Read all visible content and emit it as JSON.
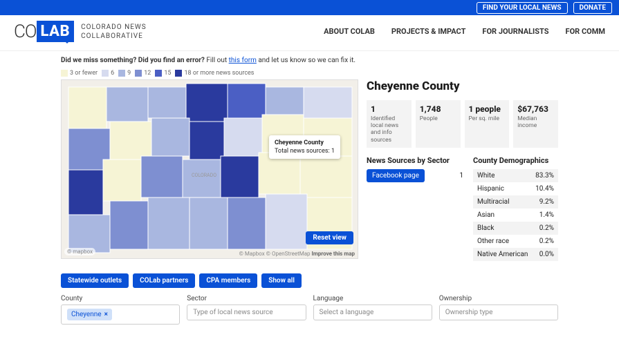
{
  "topbar": {
    "find": "FIND YOUR LOCAL NEWS",
    "donate": "DONATE"
  },
  "brand": {
    "co": "CO",
    "lab": "LAB",
    "sub1": "COLORADO NEWS",
    "sub2": "COLLABORATIVE"
  },
  "nav": {
    "about": "ABOUT COLAB",
    "projects": "PROJECTS & IMPACT",
    "journalists": "FOR JOURNALISTS",
    "comm": "FOR COMM"
  },
  "miss": {
    "b1": "Did we miss something? Did you find an error?",
    "t1": " Fill out ",
    "link": "this form",
    "t2": " and let us know so we can fix it."
  },
  "legend": {
    "a": "3 or fewer",
    "b": "6",
    "c": "9",
    "d": "12",
    "e": "15",
    "f": "18 or more news sources"
  },
  "tooltip": {
    "title": "Cheyenne County",
    "line": "Total news sources:",
    "val": "1"
  },
  "map": {
    "reset": "Reset view",
    "mapbox": "© mapbox",
    "attrib1": "© Mapbox © OpenStreetMap",
    "attrib2": "Improve this map"
  },
  "county": {
    "title": "Cheyenne County"
  },
  "stats": {
    "s1": {
      "v": "1",
      "l": "Identified local news and info sources"
    },
    "s2": {
      "v": "1,748",
      "l": "People"
    },
    "s3": {
      "v": "1 people",
      "l": "Per sq. mile"
    },
    "s4": {
      "v": "$67,763",
      "l": "Median income"
    }
  },
  "sectors": {
    "h": "News Sources by Sector",
    "fb": "Facebook page",
    "fbcount": "1"
  },
  "demo": {
    "h": "County Demographics",
    "rows": [
      {
        "k": "White",
        "v": "83.3%"
      },
      {
        "k": "Hispanic",
        "v": "10.4%"
      },
      {
        "k": "Multiracial",
        "v": "9.2%"
      },
      {
        "k": "Asian",
        "v": "1.4%"
      },
      {
        "k": "Black",
        "v": "0.2%"
      },
      {
        "k": "Other race",
        "v": "0.2%"
      },
      {
        "k": "Native American",
        "v": "0.0%"
      }
    ]
  },
  "pills": {
    "a": "Statewide outlets",
    "b": "COLab partners",
    "c": "CPA members",
    "d": "Show all"
  },
  "filters": {
    "county": {
      "label": "County",
      "tag": "Cheyenne"
    },
    "sector": {
      "label": "Sector",
      "ph": "Type of local news source"
    },
    "language": {
      "label": "Language",
      "ph": "Select a language"
    },
    "ownership": {
      "label": "Ownership",
      "ph": "Ownership type"
    }
  },
  "colors": {
    "c3": "#f6f4d5",
    "c6": "#d6dbef",
    "c9": "#a9b7e0",
    "c12": "#7e8fd1",
    "c15": "#4b5fc4",
    "c18": "#2a3a9e"
  }
}
